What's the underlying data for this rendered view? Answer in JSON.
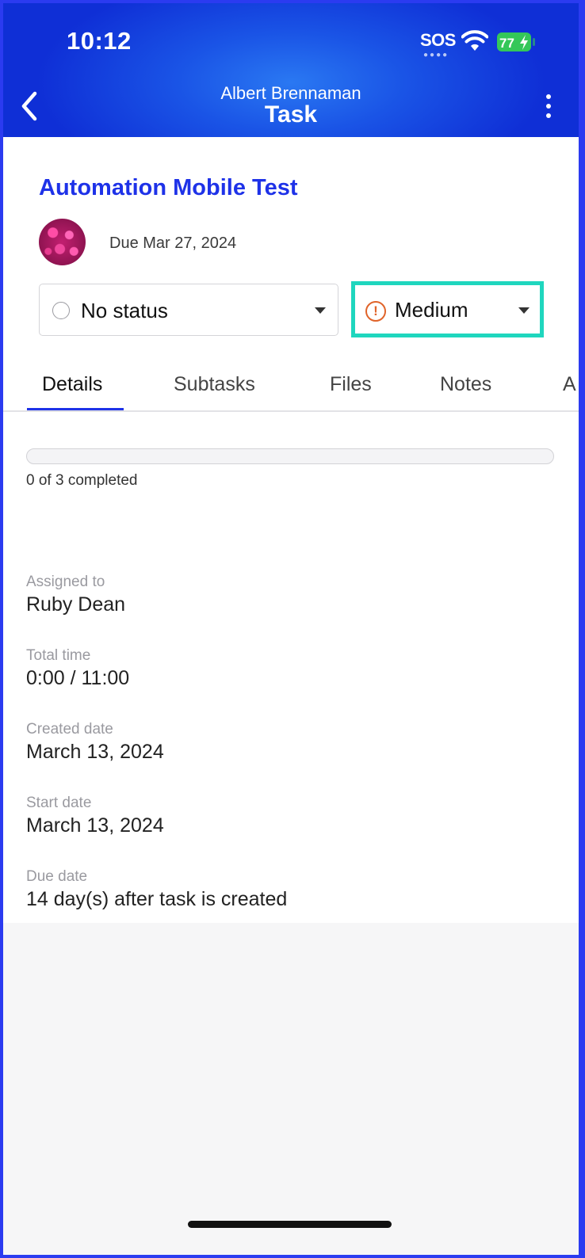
{
  "status_bar": {
    "time": "10:12",
    "sos": "SOS",
    "battery": "77"
  },
  "header": {
    "subtitle": "Albert Brennaman",
    "title": "Task"
  },
  "task": {
    "title": "Automation Mobile Test",
    "due": "Due Mar 27, 2024"
  },
  "status_select": {
    "value": "No status"
  },
  "priority_select": {
    "value": "Medium",
    "icon": "!"
  },
  "tabs": [
    {
      "label": "Details"
    },
    {
      "label": "Subtasks"
    },
    {
      "label": "Files"
    },
    {
      "label": "Notes"
    },
    {
      "label": "A"
    }
  ],
  "progress": {
    "completed": 0,
    "total": 3,
    "text": "0 of 3 completed"
  },
  "details": [
    {
      "label": "Assigned to",
      "value": "Ruby Dean"
    },
    {
      "label": "Total time",
      "value": "0:00 / 11:00"
    },
    {
      "label": "Created date",
      "value": "March 13, 2024"
    },
    {
      "label": "Start date",
      "value": "March 13, 2024"
    },
    {
      "label": "Due date",
      "value": "14 day(s) after task is created"
    }
  ],
  "colors": {
    "accent": "#1e32e8",
    "priority_highlight": "#1fd6be",
    "priority_medium": "#e0642a",
    "battery": "#34c759"
  }
}
